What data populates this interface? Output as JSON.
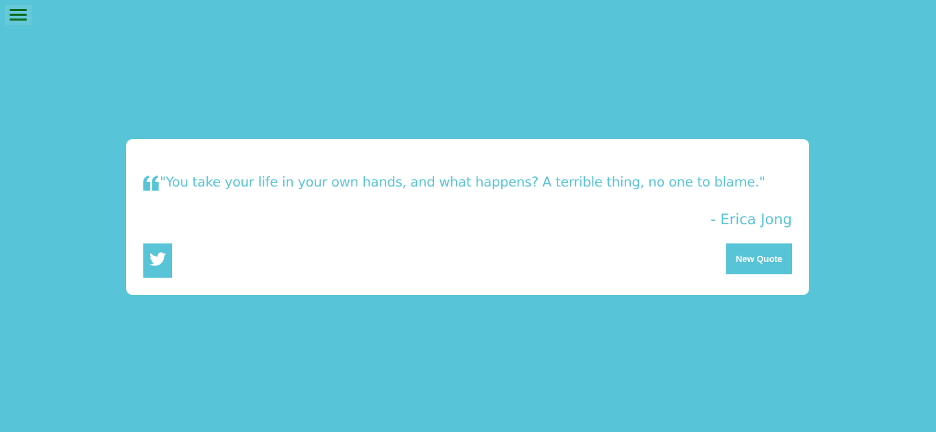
{
  "colors": {
    "background": "#58c4d8",
    "card": "#ffffff",
    "accent": "#58c4d8",
    "menu_icon": "#0b6b1e"
  },
  "nav": {
    "menu_icon": "hamburger-menu-icon"
  },
  "quote": {
    "icon": "quote-left-icon",
    "text": "\"You take your life in your own hands, and what happens? A terrible thing, no one to blame.\"",
    "author": "- Erica Jong"
  },
  "actions": {
    "tweet_icon": "twitter-icon",
    "new_quote_label": "New Quote"
  }
}
